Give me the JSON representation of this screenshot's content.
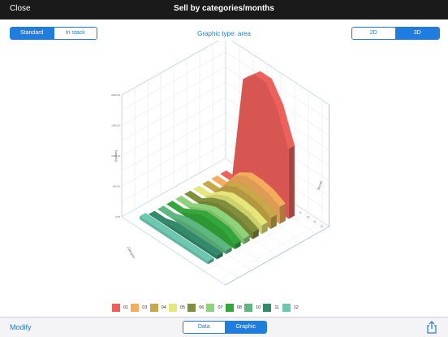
{
  "nav": {
    "close_label": "Close",
    "title": "Sell by categories/months"
  },
  "mode_segment": {
    "options": [
      "Standard",
      "In stack"
    ],
    "selected": 0
  },
  "graphic_type_label": "Graphic type: area",
  "dim_segment": {
    "options": [
      "2D",
      "3D"
    ],
    "selected": 1
  },
  "toolbar": {
    "modify_label": "Modify",
    "view_options": [
      "Data",
      "Graphic"
    ],
    "view_selected": 1
  },
  "chart_data": {
    "type": "area",
    "three_d": true,
    "xlabel": "Category",
    "ylabel": "Quantity",
    "zlabel": "Month",
    "z_axis_ticks": [
      "2000.00",
      "1500.00",
      "1000.00",
      "500.00",
      "0.00"
    ],
    "month_axis_ticks": [
      "1",
      "2",
      "3",
      "4",
      "5",
      "6",
      "7",
      "8",
      "9",
      "10",
      "11",
      "12"
    ],
    "series": [
      {
        "name": "01",
        "color": "#f0605a",
        "values": [
          1,
          1,
          1800,
          2000,
          2000,
          1700,
          1150
        ]
      },
      {
        "name": "03",
        "color": "#f5ad5c",
        "values": [
          1,
          1,
          300,
          420,
          420,
          380,
          280
        ]
      },
      {
        "name": "04",
        "color": "#c8a848",
        "values": [
          1,
          1,
          220,
          320,
          320,
          290,
          180
        ]
      },
      {
        "name": "05",
        "color": "#e5e77a",
        "values": [
          1,
          1,
          160,
          250,
          250,
          220,
          140
        ]
      },
      {
        "name": "06",
        "color": "#7f8f3a",
        "values": [
          1,
          1,
          130,
          210,
          210,
          190,
          110
        ]
      },
      {
        "name": "07",
        "color": "#8dd37a",
        "values": [
          1,
          1,
          110,
          190,
          190,
          170,
          90
        ]
      },
      {
        "name": "08",
        "color": "#33a83a",
        "values": [
          1,
          1,
          100,
          200,
          200,
          180,
          80
        ]
      },
      {
        "name": "10",
        "color": "#5cb87f",
        "values": [
          1,
          1,
          70,
          90,
          90,
          80,
          60
        ]
      },
      {
        "name": "11",
        "color": "#338a6a",
        "values": [
          1,
          1,
          60,
          60,
          60,
          60,
          60
        ]
      },
      {
        "name": "12",
        "color": "#6cc8b0",
        "values": [
          50,
          50,
          50,
          50,
          50,
          50,
          50
        ]
      }
    ],
    "legend_position": "bottom"
  },
  "colors": {
    "accent": "#1f7de0",
    "navbar": "#1a1a1a"
  }
}
